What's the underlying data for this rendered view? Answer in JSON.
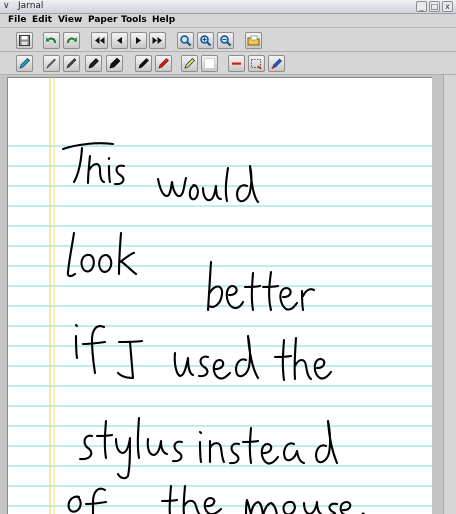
{
  "window": {
    "title": "Jarnal",
    "menu_glyph": "∨",
    "minimize": "_",
    "maximize": "□",
    "close": "x"
  },
  "menubar": {
    "items": [
      "File",
      "Edit",
      "View",
      "Paper",
      "Tools",
      "Help"
    ]
  },
  "toolbar": {
    "row1": [
      "save-icon",
      "undo-icon",
      "redo-icon",
      "first-page-icon",
      "previous-page-icon",
      "next-page-icon",
      "last-page-icon",
      "zoom-icon",
      "zoom-in-icon",
      "zoom-out-icon",
      "open-folder-icon"
    ],
    "row2": [
      "pen-icon",
      "pen-fine-icon",
      "pen-medium-icon",
      "pen-thick-icon",
      "pen-black-icon",
      "pen-red-icon",
      "highlighter-icon",
      "eraser-icon",
      "line-icon",
      "select-icon",
      "clear-icon"
    ]
  },
  "page": {
    "ruling_color": "#7fd8e0",
    "margin_color": "#f0e08c",
    "ink_color": "#000000",
    "handwriting_lines": [
      "This would",
      "look better",
      "if I used the",
      "stylus instead",
      "of the mouse."
    ]
  }
}
